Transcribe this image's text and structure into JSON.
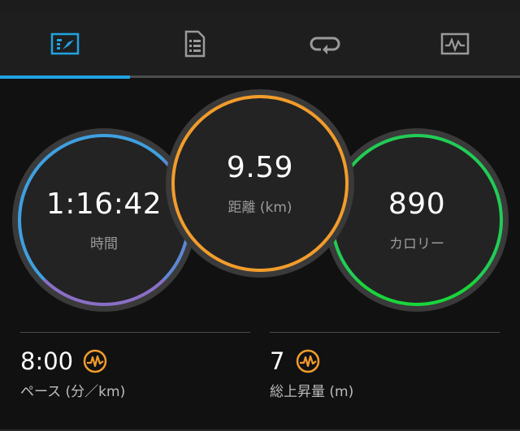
{
  "tabs": [
    {
      "name": "tab-overview",
      "icon": "dashboard-icon",
      "active": true
    },
    {
      "name": "tab-details",
      "icon": "document-list-icon",
      "active": false
    },
    {
      "name": "tab-laps",
      "icon": "laps-icon",
      "active": false
    },
    {
      "name": "tab-charts",
      "icon": "chart-icon",
      "active": false
    }
  ],
  "metrics": {
    "time": {
      "value": "1:16:42",
      "label": "時間",
      "colors": [
        "#3fa0e0",
        "#8a6fc7"
      ]
    },
    "distance": {
      "value": "9.59",
      "label": "距離 (km)",
      "color": "#f29c2b"
    },
    "calories": {
      "value": "890",
      "label": "カロリー",
      "colors": [
        "#22cc55",
        "#1aa84a"
      ]
    }
  },
  "stats": {
    "pace": {
      "value": "8:00",
      "label": "ペース (分／km)",
      "icon": "pulse-icon"
    },
    "elevation": {
      "value": "7",
      "label": "総上昇量 (m)",
      "icon": "pulse-icon"
    }
  },
  "colors": {
    "accent": "#1fa3e0",
    "background": "#111111",
    "icon_orange": "#f29c2b"
  }
}
